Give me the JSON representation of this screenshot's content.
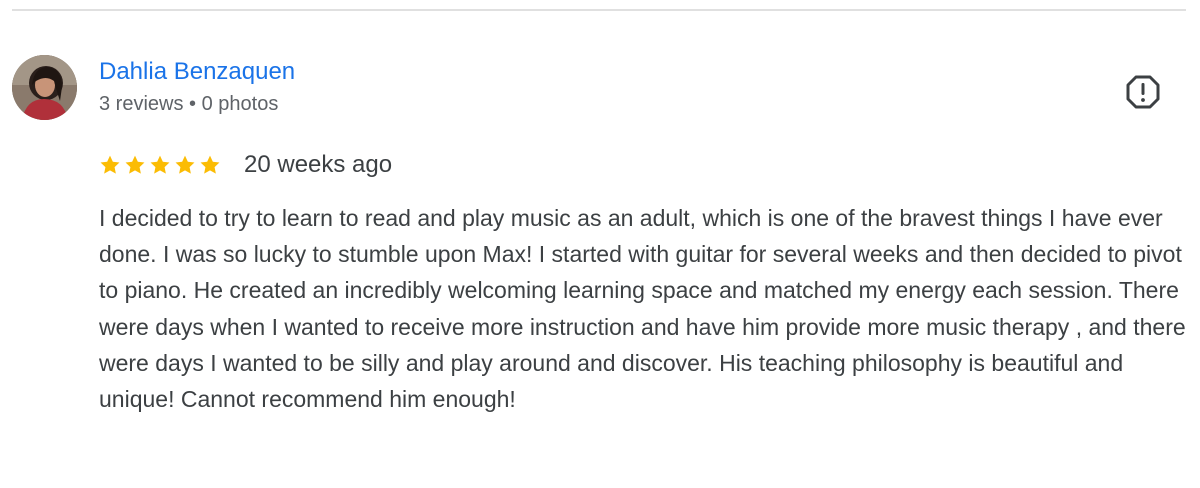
{
  "review": {
    "reviewer_name": "Dahlia Benzaquen",
    "reviewer_meta": "3 reviews • 0 photos",
    "rating": 5,
    "rating_max": 5,
    "date": "20 weeks ago",
    "text": "I decided to try to learn to read and play music as an adult, which is one of the bravest things I have ever done. I was so lucky to stumble upon Max! I started with guitar for several weeks and then decided to pivot to piano. He created an incredibly welcoming learning space and matched my energy each session. There were days when I wanted to receive more instruction and have him provide more music therapy , and there were days I wanted to be silly and play around and discover. His teaching philosophy is beautiful and unique! Cannot recommend him enough!"
  },
  "icons": {
    "flag": "report-flag-icon",
    "star": "star-icon",
    "avatar": "avatar-photo"
  },
  "colors": {
    "name_link": "#1a73e8",
    "meta_text": "#5f6368",
    "body_text": "#3c4043",
    "star": "#fbbc04",
    "divider": "#e0e0e0"
  }
}
